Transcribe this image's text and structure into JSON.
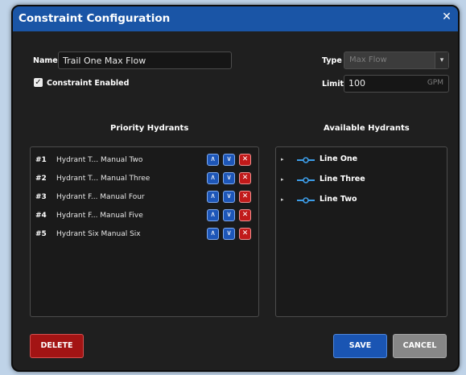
{
  "dialog": {
    "title": "Constraint Configuration",
    "close_glyph": "✕"
  },
  "form": {
    "name_label": "Name",
    "name_value": "Trail One Max Flow",
    "enabled_label": "Constraint Enabled",
    "enabled_checked": true,
    "check_glyph": "✓",
    "type_label": "Type",
    "type_value": "Max Flow",
    "type_arrow": "▾",
    "limit_label": "Limit",
    "limit_value": "100",
    "limit_unit": "GPM"
  },
  "priority": {
    "title": "Priority Hydrants",
    "up_glyph": "∧",
    "down_glyph": "∨",
    "remove_glyph": "✕",
    "rows": [
      {
        "num": "#1",
        "name": "Hydrant T... Manual Two"
      },
      {
        "num": "#2",
        "name": "Hydrant T... Manual Three"
      },
      {
        "num": "#3",
        "name": "Hydrant F... Manual Four"
      },
      {
        "num": "#4",
        "name": "Hydrant F... Manual Five"
      },
      {
        "num": "#5",
        "name": "Hydrant Six Manual Six"
      }
    ]
  },
  "available": {
    "title": "Available Hydrants",
    "caret_glyph": "▸",
    "items": [
      {
        "name": "Line One"
      },
      {
        "name": "Line Three"
      },
      {
        "name": "Line Two"
      }
    ]
  },
  "buttons": {
    "delete": "DELETE",
    "save": "SAVE",
    "cancel": "CANCEL"
  },
  "colors": {
    "titlebar": "#1a55a6",
    "dialog_bg": "#1f1f1f",
    "accent_blue": "#1d56b8",
    "danger_red": "#c11a1a",
    "line_icon": "#3d9de8"
  }
}
